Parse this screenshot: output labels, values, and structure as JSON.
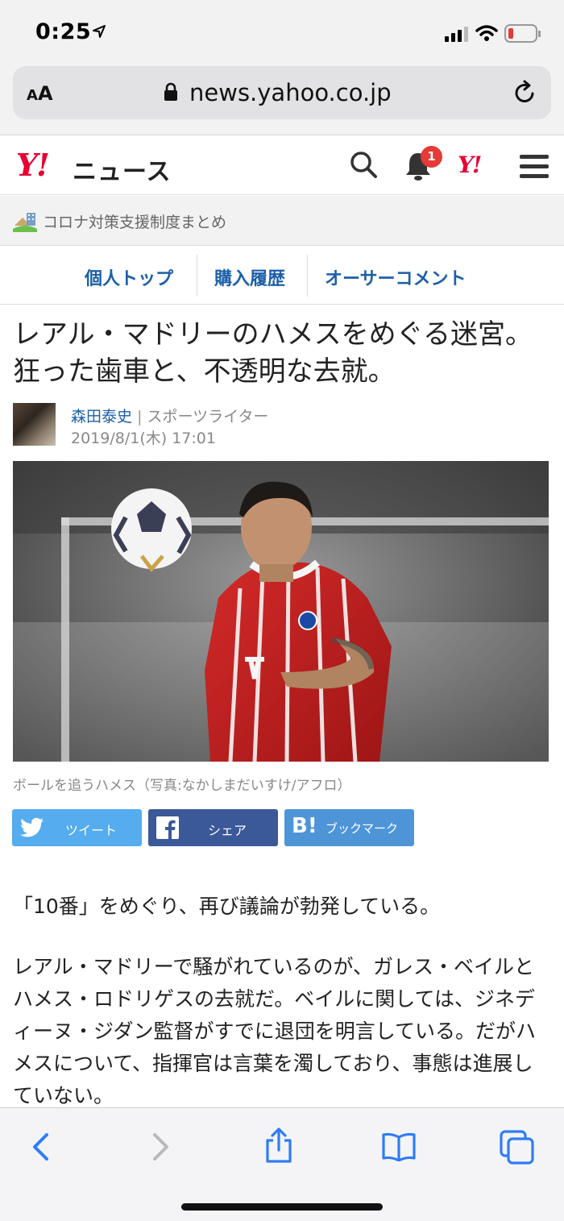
{
  "status_bar": {
    "time": "0:25"
  },
  "browser": {
    "aa_label_small": "A",
    "aa_label_large": "A",
    "url": "news.yahoo.co.jp"
  },
  "header": {
    "logo_text": "Y!",
    "section_title": "ニュース",
    "notification_count": "1",
    "right_logo_text": "Y!"
  },
  "banner": {
    "text": "コロナ対策支援制度まとめ"
  },
  "tabs": [
    {
      "label": "個人トップ"
    },
    {
      "label": "購入履歴"
    },
    {
      "label": "オーサーコメント"
    }
  ],
  "article": {
    "title": "レアル・マドリーのハメスをめぐる迷宮。狂った歯車と、不透明な去就。",
    "author_name": "森田泰史",
    "author_separator": "|",
    "author_role": "スポーツライター",
    "date": "2019/8/1(木) 17:01",
    "caption": "ボールを追うハメス（写真:なかしまだいすけ/アフロ）",
    "paragraphs": [
      "「10番」をめぐり、再び議論が勃発している。",
      "レアル・マドリーで騒がれているのが、ガレス・ベイルとハメス・ロドリゲスの去就だ。ベイルに関しては、ジネディーヌ・ジダン監督がすでに退団を明言している。だがハメスについて、指揮官は言葉を濁しており、事態は進展していない。"
    ]
  },
  "share": {
    "twitter_label": "ツイート",
    "facebook_label": "シェア",
    "hatena_label": "ブックマーク",
    "hatena_logo": "B!"
  },
  "colors": {
    "yahoo_red": "#e60033",
    "link_blue": "#1c5fa8",
    "twitter": "#55acee",
    "facebook": "#3b5998",
    "hatena": "#4e95d8",
    "ios_blue": "#2f7cf6"
  }
}
